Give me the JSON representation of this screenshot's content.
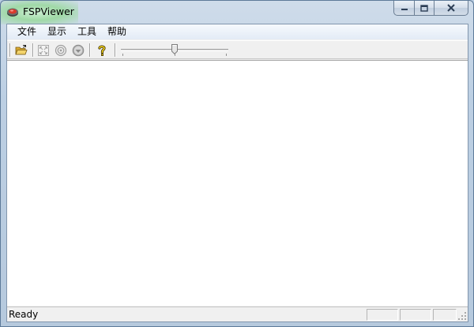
{
  "window": {
    "title": "FSPViewer"
  },
  "menu": {
    "items": [
      "文件",
      "显示",
      "工具",
      "帮助"
    ]
  },
  "toolbar": {
    "buttons": [
      {
        "icon": "open-folder-icon",
        "enabled": true
      },
      {
        "icon": "fit-to-window-icon",
        "enabled": false
      },
      {
        "icon": "zoom-target-icon",
        "enabled": false
      },
      {
        "icon": "navigate-icon",
        "enabled": false
      },
      {
        "icon": "help-icon",
        "enabled": true
      }
    ],
    "slider_position": 0.5
  },
  "status": {
    "text": "Ready"
  },
  "colors": {
    "title_glow": "#9fd9a6",
    "client_bg": "#f0f0f0",
    "view_bg": "#ffffff",
    "help_icon": "#e8c21a",
    "folder_icon": "#e3b93b"
  }
}
